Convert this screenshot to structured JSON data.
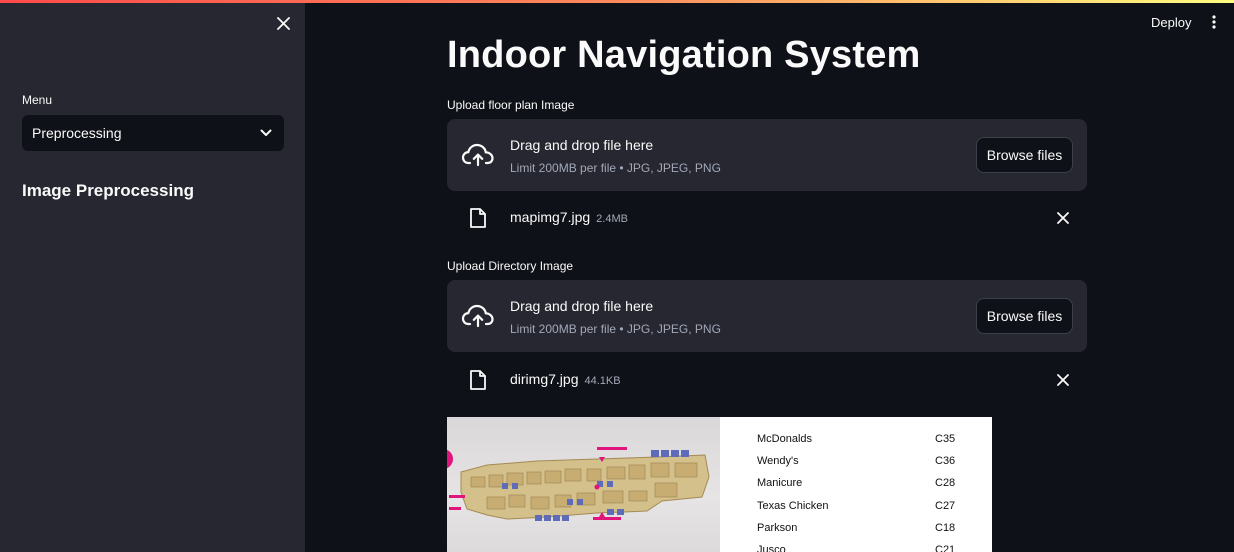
{
  "sidebar": {
    "menu_label": "Menu",
    "menu_selected": "Preprocessing",
    "section_heading": "Image Preprocessing"
  },
  "header": {
    "deploy_label": "Deploy"
  },
  "main": {
    "title": "Indoor Navigation System",
    "uploaders": [
      {
        "label": "Upload floor plan Image",
        "drop_text": "Drag and drop file here",
        "limit_text": "Limit 200MB per file • JPG, JPEG, PNG",
        "browse_label": "Browse files",
        "file": {
          "name": "mapimg7.jpg",
          "size": "2.4MB"
        }
      },
      {
        "label": "Upload Directory Image",
        "drop_text": "Drag and drop file here",
        "limit_text": "Limit 200MB per file • JPG, JPEG, PNG",
        "browse_label": "Browse files",
        "file": {
          "name": "dirimg7.jpg",
          "size": "44.1KB"
        }
      }
    ],
    "directory_entries": [
      {
        "name": "McDonalds",
        "code": "C35"
      },
      {
        "name": "Wendy's",
        "code": "C36"
      },
      {
        "name": "Manicure",
        "code": "C28"
      },
      {
        "name": "Texas Chicken",
        "code": "C27"
      },
      {
        "name": "Parkson",
        "code": "C18"
      },
      {
        "name": "Jusco",
        "code": "C21"
      }
    ]
  },
  "colors": {
    "background": "#0e1117",
    "sidebar": "#262730",
    "dropzone": "#262730",
    "accent_start": "#ff4b4b",
    "accent_end": "#fffd80",
    "muted_text": "#a3a8b8"
  },
  "icons": {
    "close": "close-icon",
    "chevron": "chevron-down-icon",
    "upload": "cloud-upload-icon",
    "file": "file-icon",
    "menu": "kebab-menu-icon"
  }
}
